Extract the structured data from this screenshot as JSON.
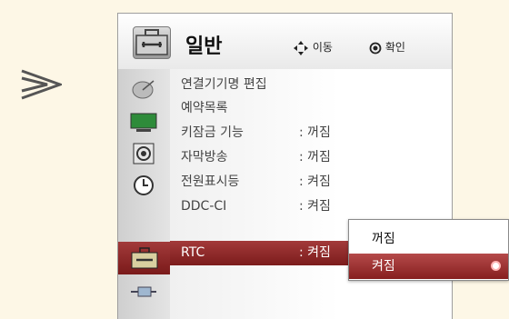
{
  "header": {
    "title": "일반",
    "hint_move": "이동",
    "hint_ok": "확인"
  },
  "sidebar": {
    "icons": [
      "satellite-dish-icon",
      "monitor-icon",
      "speaker-icon",
      "clock-icon",
      "toolbox-icon",
      "connector-icon"
    ]
  },
  "menu": {
    "items": [
      {
        "label": "연결기기명 편집",
        "value": ""
      },
      {
        "label": "예약목록",
        "value": ""
      },
      {
        "label": "키잠금 기능",
        "value": ": 꺼짐"
      },
      {
        "label": "자막방송",
        "value": ": 꺼짐"
      },
      {
        "label": "전원표시등",
        "value": ": 켜짐"
      },
      {
        "label": "DDC-CI",
        "value": ": 켜짐"
      },
      {
        "label": "RTC",
        "value": ": 켜짐"
      }
    ]
  },
  "popup": {
    "options": [
      {
        "label": "꺼짐"
      },
      {
        "label": "켜짐"
      }
    ]
  }
}
